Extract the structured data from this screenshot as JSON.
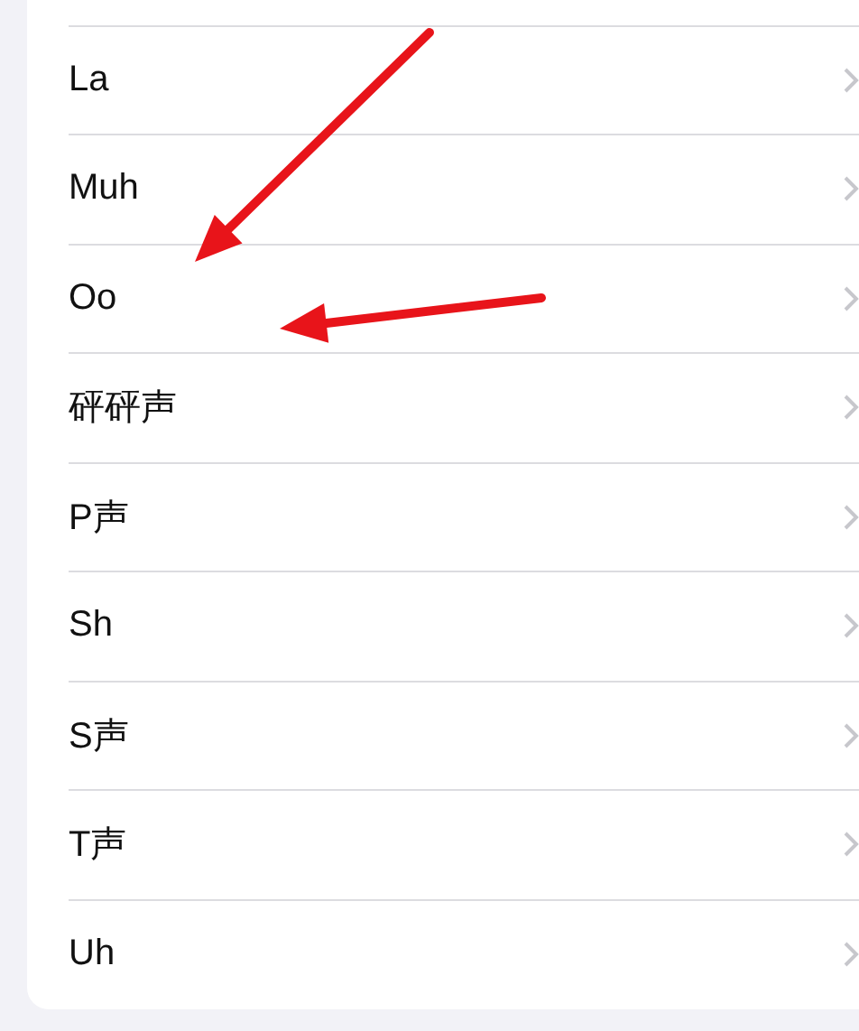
{
  "list": {
    "items": [
      {
        "label": "La"
      },
      {
        "label": "Muh"
      },
      {
        "label": "Oo"
      },
      {
        "label": "砰砰声"
      },
      {
        "label": "P声"
      },
      {
        "label": "Sh"
      },
      {
        "label": "S声"
      },
      {
        "label": "T声"
      },
      {
        "label": "Uh"
      }
    ]
  },
  "annotations": [
    {
      "kind": "arrow"
    },
    {
      "kind": "arrow"
    }
  ]
}
